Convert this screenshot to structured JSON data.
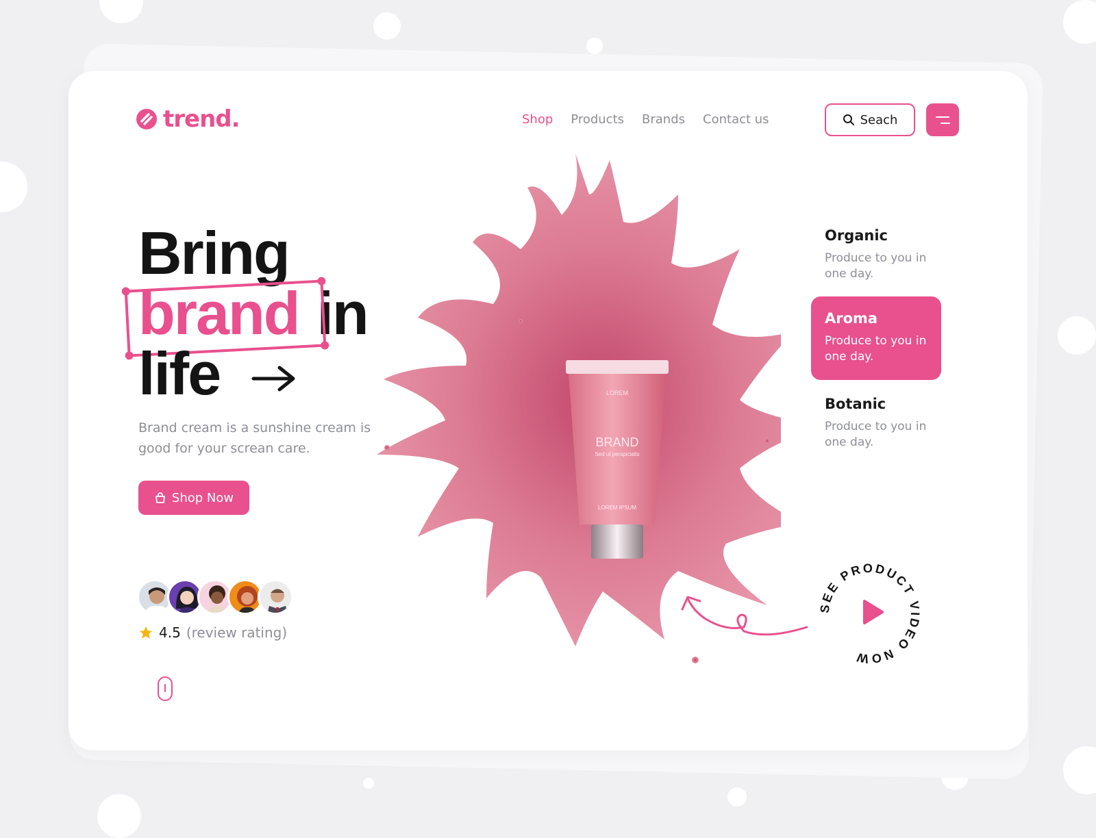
{
  "header": {
    "logo": "trend.",
    "nav": [
      "Shop",
      "Products",
      "Brands",
      "Contact us"
    ],
    "search_label": "Seach"
  },
  "hero": {
    "line1": "Bring",
    "line2_highlight": "brand",
    "line2_rest": "in",
    "line3": "life",
    "description": "Brand cream is a sunshine cream is good for your screan care.",
    "cta": "Shop Now",
    "rating_value": "4.5",
    "rating_label": "(review rating)"
  },
  "product": {
    "cap_text": "LOREM",
    "brand_text": "BRAND",
    "sub_text": "Sed ut perspiciatis",
    "bottom_text": "LOREM IPSUM"
  },
  "features": [
    {
      "title": "Organic",
      "desc": "Produce to you in one day."
    },
    {
      "title": "Aroma",
      "desc": "Produce to you in one day."
    },
    {
      "title": "Botanic",
      "desc": "Produce to you in one day."
    }
  ],
  "video_badge": "SEE PRODUCT VIDEO NOW",
  "colors": {
    "accent": "#e9508e",
    "text": "#141414",
    "muted": "#8e8e99"
  },
  "icons": [
    "logo-mark-icon",
    "search-icon",
    "menu-icon",
    "arrow-right-icon",
    "bag-icon",
    "star-icon",
    "mouse-scroll-icon",
    "play-icon"
  ]
}
